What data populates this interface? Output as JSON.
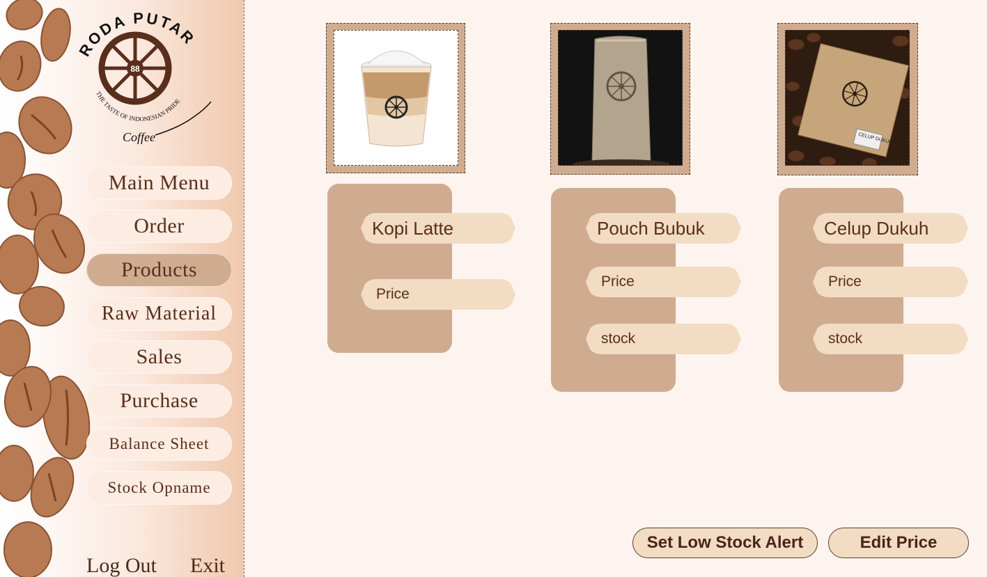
{
  "brand": {
    "name": "RODA PUTAR",
    "number": "88",
    "tagline": "THE TASTE OF INDONESIAN PRIDE",
    "sub": "Coffee"
  },
  "nav": {
    "main_menu": "Main Menu",
    "order": "Order",
    "products": "Products",
    "raw_material": "Raw Material",
    "sales": "Sales",
    "purchase": "Purchase",
    "balance_sheet": "Balance Sheet",
    "stock_opname": "Stock Opname",
    "log_out": "Log Out",
    "exit": "Exit",
    "active": "products"
  },
  "products": [
    {
      "name": "Kopi Latte",
      "price_placeholder": "Price",
      "stock_placeholder": ""
    },
    {
      "name": "Pouch Bubuk",
      "price_placeholder": "Price",
      "stock_placeholder": "stock"
    },
    {
      "name": "Celup Dukuh",
      "price_placeholder": "Price",
      "stock_placeholder": "stock",
      "box_label": "CELUP DUKUH"
    }
  ],
  "actions": {
    "low_stock": "Set Low Stock Alert",
    "edit_price": "Edit Price"
  },
  "colors": {
    "background": "#fdf4ef",
    "panel": "#cfac90",
    "pill": "#f2dcc4",
    "text": "#5a2e1c"
  }
}
